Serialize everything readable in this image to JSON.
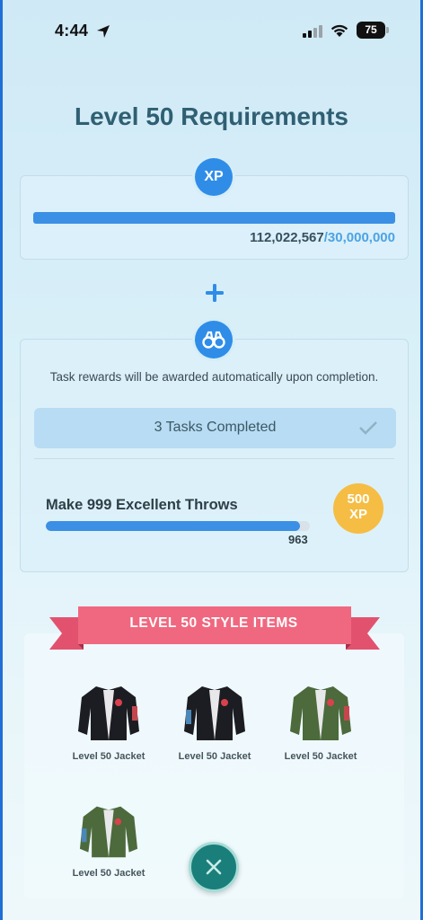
{
  "status_bar": {
    "time": "4:44",
    "battery": "75"
  },
  "title": "Level 50 Requirements",
  "xp": {
    "badge": "XP",
    "current": "112,022,567",
    "goal": "/30,000,000",
    "progress": 1.0
  },
  "tasks": {
    "note": "Task rewards will be awarded automatically upon completion.",
    "completed_label": "3 Tasks Completed",
    "task": {
      "name": "Make 999 Excellent Throws",
      "count": "963",
      "progress": 0.964,
      "reward_amount": "500",
      "reward_unit": "XP"
    }
  },
  "style_items": {
    "banner": "LEVEL 50 STYLE ITEMS",
    "items": [
      {
        "label": "Level 50 Jacket",
        "color": "#1c1d22"
      },
      {
        "label": "Level 50 Jacket",
        "color": "#1c1d22"
      },
      {
        "label": "Level 50 Jacket",
        "color": "#4c6a3c"
      },
      {
        "label": "Level 50 Jacket",
        "color": "#4c6a3c"
      }
    ]
  },
  "colors": {
    "accent": "#2f8de8",
    "reward": "#f5bd43",
    "ribbon": "#ef5e7a",
    "close": "#1a7f7b"
  }
}
